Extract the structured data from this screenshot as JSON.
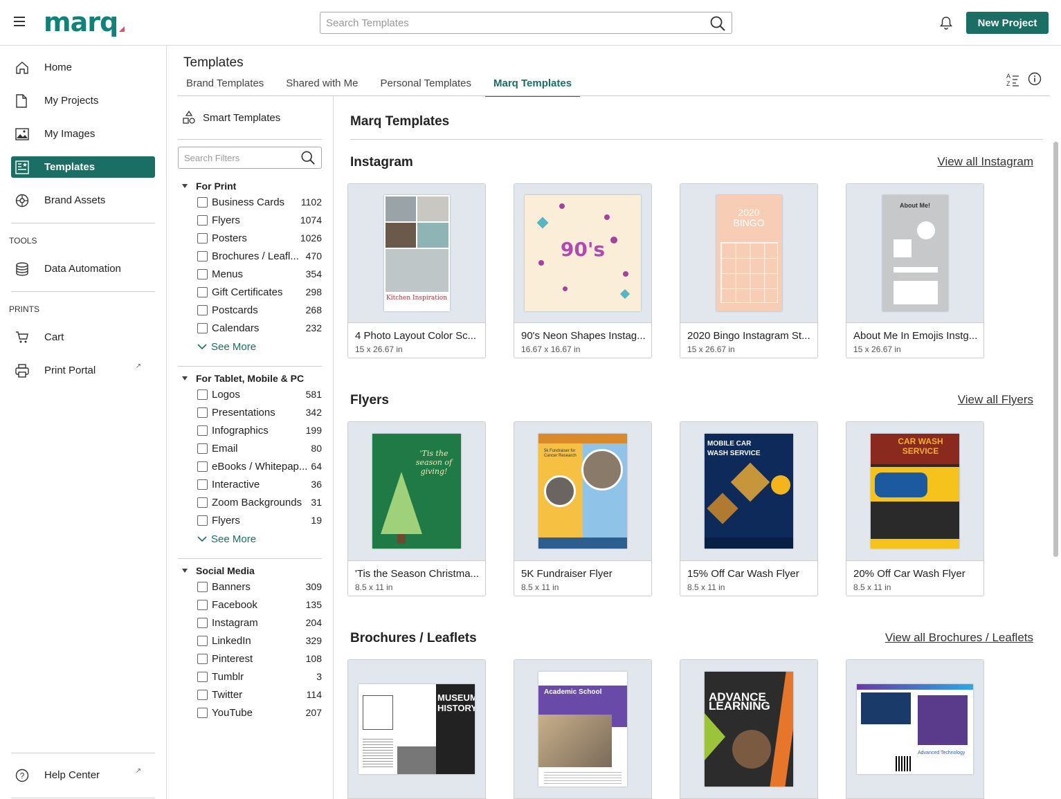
{
  "header": {
    "logo": "marq",
    "search_placeholder": "Search Templates",
    "new_project": "New Project"
  },
  "sidebar": {
    "items": [
      {
        "label": "Home",
        "icon": "home-icon"
      },
      {
        "label": "My Projects",
        "icon": "document-icon"
      },
      {
        "label": "My Images",
        "icon": "image-icon"
      },
      {
        "label": "Templates",
        "icon": "templates-icon"
      },
      {
        "label": "Brand Assets",
        "icon": "palette-icon"
      }
    ],
    "tools_header": "TOOLS",
    "data_automation": "Data Automation",
    "prints_header": "PRINTS",
    "cart": "Cart",
    "print_portal": "Print Portal",
    "help_center": "Help Center"
  },
  "page": {
    "title": "Templates",
    "tabs": [
      "Brand Templates",
      "Shared with Me",
      "Personal Templates",
      "Marq Templates"
    ],
    "active_tab": "Marq Templates"
  },
  "filters": {
    "smart_templates": "Smart Templates",
    "search_placeholder": "Search Filters",
    "see_more": "See More",
    "groups": [
      {
        "title": "For Print",
        "items": [
          {
            "label": "Business Cards",
            "count": "1102"
          },
          {
            "label": "Flyers",
            "count": "1074"
          },
          {
            "label": "Posters",
            "count": "1026"
          },
          {
            "label": "Brochures / Leafl...",
            "count": "470"
          },
          {
            "label": "Menus",
            "count": "354"
          },
          {
            "label": "Gift Certificates",
            "count": "298"
          },
          {
            "label": "Postcards",
            "count": "268"
          },
          {
            "label": "Calendars",
            "count": "232"
          }
        ]
      },
      {
        "title": "For Tablet, Mobile & PC",
        "items": [
          {
            "label": "Logos",
            "count": "581"
          },
          {
            "label": "Presentations",
            "count": "342"
          },
          {
            "label": "Infographics",
            "count": "199"
          },
          {
            "label": "Email",
            "count": "80"
          },
          {
            "label": "eBooks / Whitepap...",
            "count": "64"
          },
          {
            "label": "Interactive",
            "count": "36"
          },
          {
            "label": "Zoom Backgrounds",
            "count": "31"
          },
          {
            "label": "Flyers",
            "count": "19"
          }
        ]
      },
      {
        "title": "Social Media",
        "items": [
          {
            "label": "Banners",
            "count": "309"
          },
          {
            "label": "Facebook",
            "count": "135"
          },
          {
            "label": "Instagram",
            "count": "204"
          },
          {
            "label": "LinkedIn",
            "count": "329"
          },
          {
            "label": "Pinterest",
            "count": "108"
          },
          {
            "label": "Tumblr",
            "count": "3"
          },
          {
            "label": "Twitter",
            "count": "114"
          },
          {
            "label": "YouTube",
            "count": "207"
          }
        ]
      }
    ]
  },
  "content": {
    "title": "Marq Templates",
    "sections": [
      {
        "title": "Instagram",
        "view_all": "View all Instagram",
        "cards": [
          {
            "name": "4 Photo Layout Color Sc...",
            "size": "15 x 26.67 in",
            "thumb_text": "Kitchen Inspiration"
          },
          {
            "name": "90's Neon Shapes Instag...",
            "size": "16.67 x 16.67 in",
            "thumb_text": "90's"
          },
          {
            "name": "2020 Bingo Instagram St...",
            "size": "15 x 26.67 in",
            "thumb_text": "2020 BINGO"
          },
          {
            "name": "About Me In Emojis Instg...",
            "size": "15 x 26.67 in",
            "thumb_text": "About Me!"
          }
        ]
      },
      {
        "title": "Flyers",
        "view_all": "View all Flyers",
        "cards": [
          {
            "name": "'Tis the Season Christma...",
            "size": "8.5 x 11 in",
            "thumb_text": "'Tis the season of giving!"
          },
          {
            "name": "5K Fundraiser Flyer",
            "size": "8.5 x 11 in",
            "thumb_text": "5k Fundraiser for Cancer Research"
          },
          {
            "name": "15% Off Car Wash Flyer",
            "size": "8.5 x 11 in",
            "thumb_text": "MOBILE CAR WASH SERVICE"
          },
          {
            "name": "20% Off Car Wash Flyer",
            "size": "8.5 x 11 in",
            "thumb_text": "CAR WASH SERVICE"
          }
        ]
      },
      {
        "title": "Brochures / Leaflets",
        "view_all": "View all Brochures / Leaflets",
        "cards": [
          {
            "name": "",
            "size": "",
            "thumb_text": "MUSEUM HISTORY"
          },
          {
            "name": "",
            "size": "",
            "thumb_text": "Academic School"
          },
          {
            "name": "",
            "size": "",
            "thumb_text": "ADVANCE LEARNING"
          },
          {
            "name": "",
            "size": "",
            "thumb_text": "Advanced Technology"
          }
        ]
      }
    ]
  },
  "colors": {
    "brand": "#1b6e63",
    "logo": "#11827a",
    "logo_accent": "#e84a5f"
  }
}
